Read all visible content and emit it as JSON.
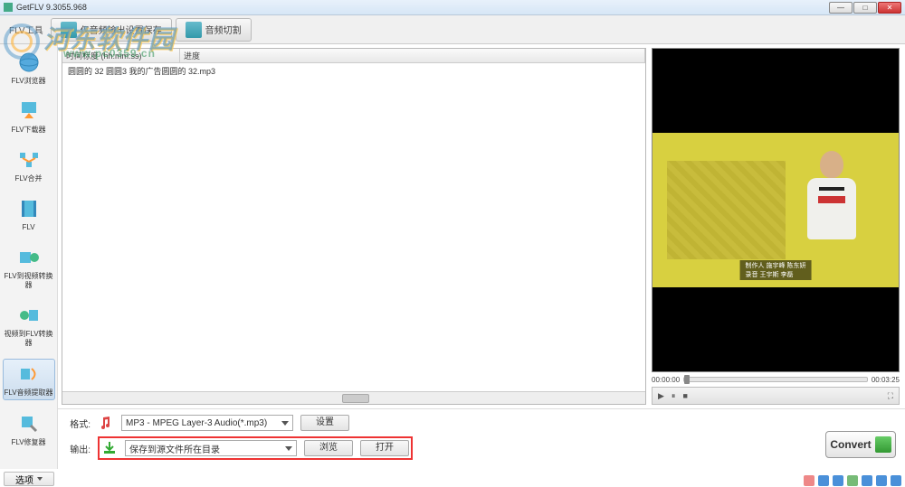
{
  "window": {
    "title": "GetFLV 9.3055.968"
  },
  "winbtns": {
    "min": "—",
    "max": "□",
    "close": "✕"
  },
  "menubar": {
    "section": "FLV工具",
    "tab1": "仅音频输出设置保存",
    "tab2": "音频切割"
  },
  "watermark": {
    "text": "河东软件园",
    "url": "www.pc0359.cn"
  },
  "sidebar": {
    "items": [
      {
        "label": "FLV浏览器"
      },
      {
        "label": "FLV下载器"
      },
      {
        "label": "FLV合并"
      },
      {
        "label": "FLV"
      },
      {
        "label": "FLV到视频转换器"
      },
      {
        "label": "视频到FLV转换器"
      },
      {
        "label": "FLV音频提取器"
      },
      {
        "label": "FLV修复器"
      }
    ]
  },
  "list": {
    "col1": "时间标度 (hh:mm:ss)",
    "col2": "进度",
    "row": "圆圆的 32    圆圆3    我的广告圆圆的 32.mp3"
  },
  "format": {
    "label": "格式:",
    "value": "MP3 - MPEG Layer-3 Audio(*.mp3)",
    "settings": "设置"
  },
  "output": {
    "label": "输出:",
    "value": "保存到源文件所在目录",
    "browse": "浏览",
    "open": "打开"
  },
  "options": {
    "label": "选项"
  },
  "preview": {
    "caption1": "制作人 施宇峰 陈东妍",
    "caption2": "录音 王宇斯 李磊",
    "t0": "00:00:00",
    "t1": "00:03:25",
    "play": "▶",
    "pause": "⏸",
    "stop": "■",
    "full": "⛶"
  },
  "convert": {
    "label": "Convert"
  }
}
